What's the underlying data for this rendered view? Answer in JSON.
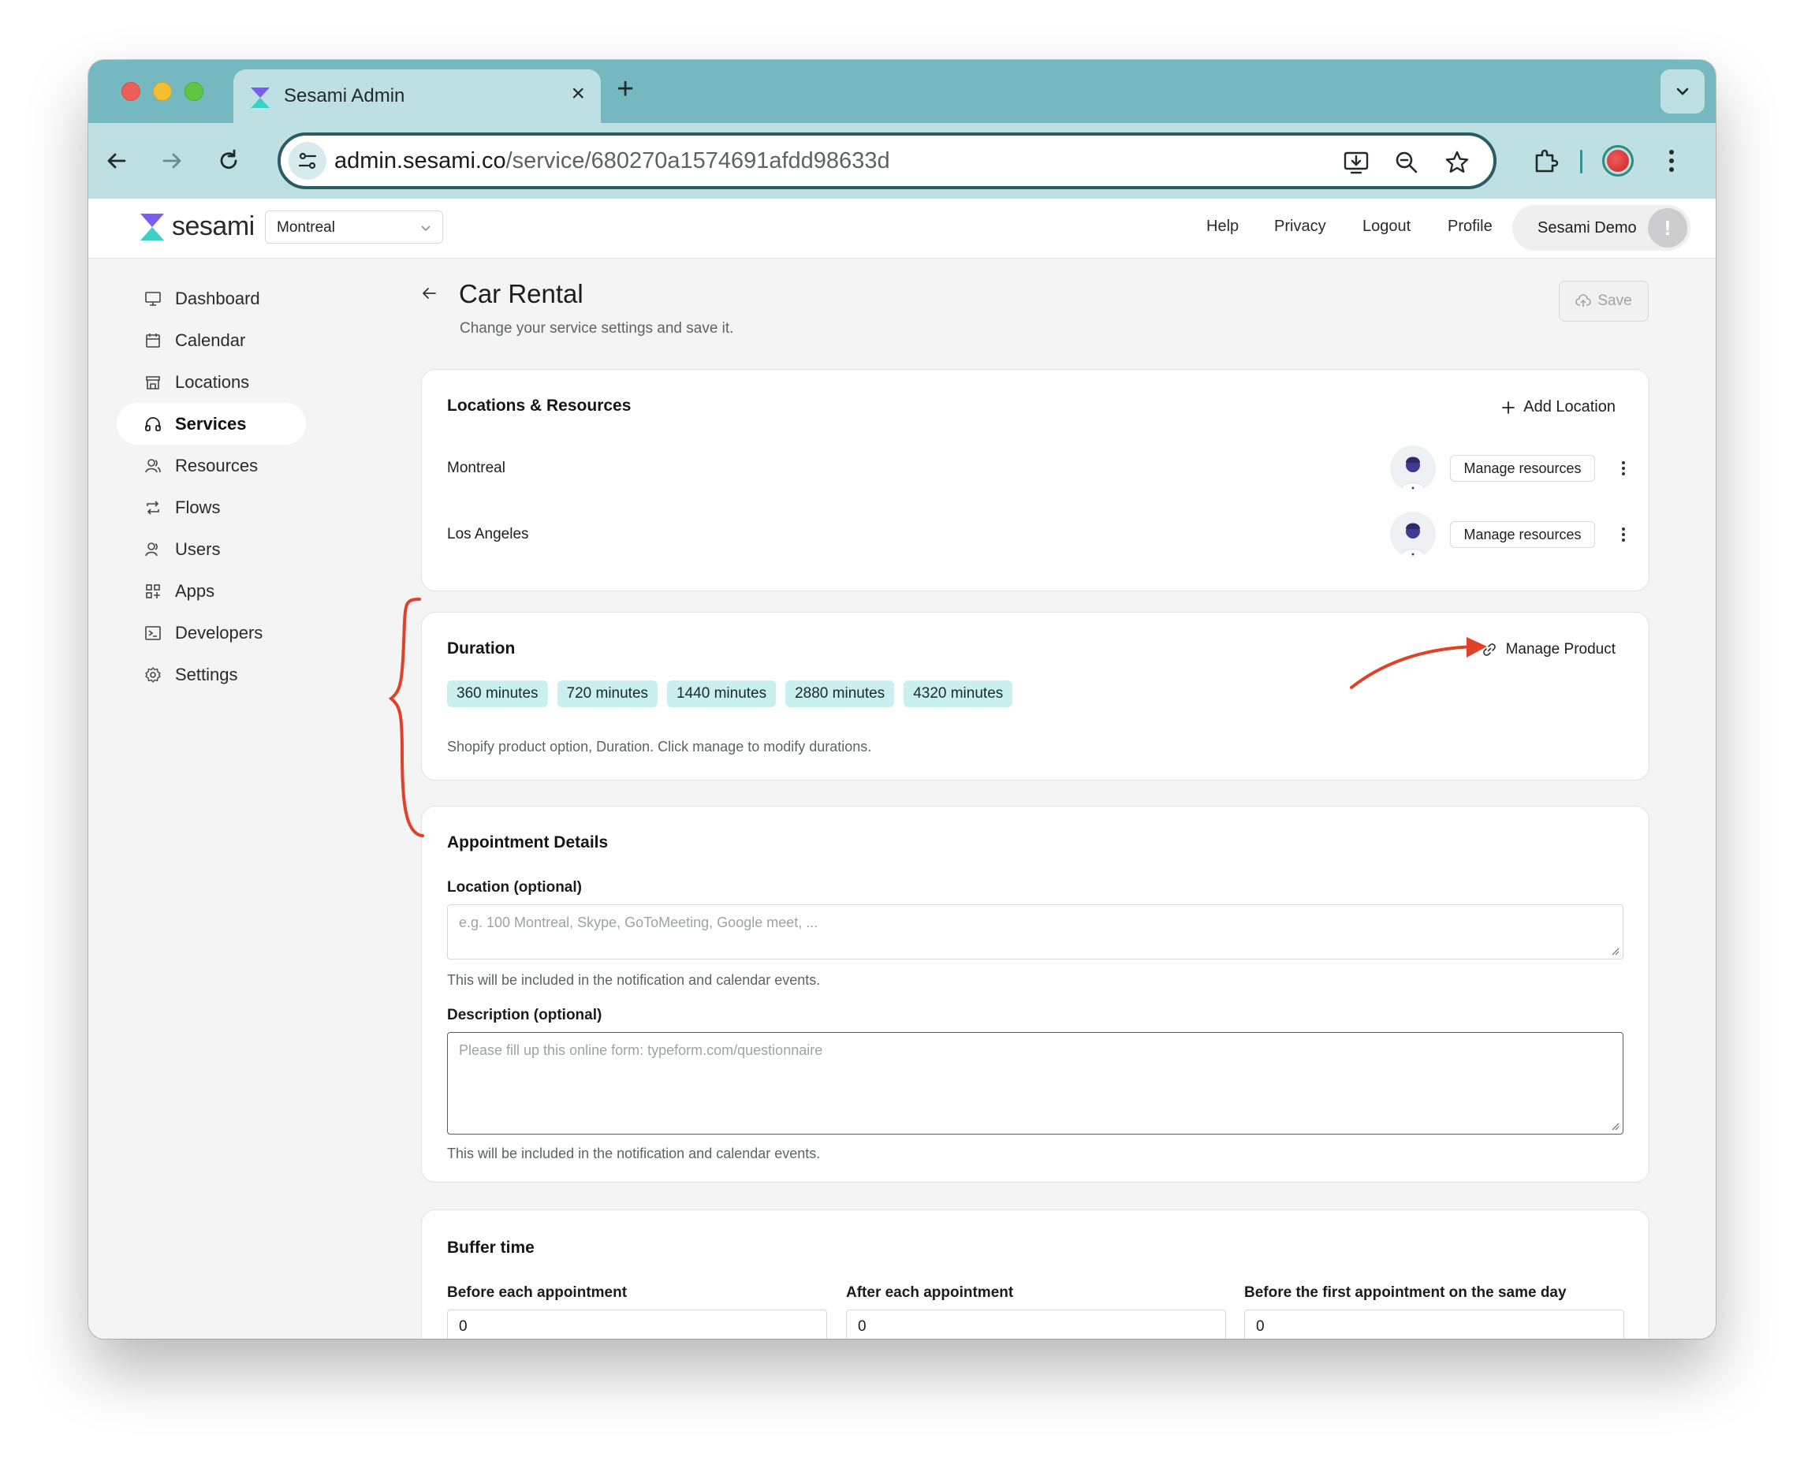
{
  "browser": {
    "tab_title": "Sesami Admin",
    "url_host": "admin.sesami.co",
    "url_path": "/service/680270a1574691afdd98633d"
  },
  "header": {
    "logo_text": "sesami",
    "location_select": "Montreal",
    "links": {
      "help": "Help",
      "privacy": "Privacy",
      "logout": "Logout",
      "profile": "Profile"
    },
    "user_name": "Sesami Demo",
    "user_avatar": "!"
  },
  "sidebar": {
    "items": [
      {
        "label": "Dashboard",
        "icon": "monitor-icon"
      },
      {
        "label": "Calendar",
        "icon": "calendar-icon"
      },
      {
        "label": "Locations",
        "icon": "store-icon"
      },
      {
        "label": "Services",
        "icon": "headphones-icon",
        "active": true
      },
      {
        "label": "Resources",
        "icon": "users-icon"
      },
      {
        "label": "Flows",
        "icon": "repeat-icon"
      },
      {
        "label": "Users",
        "icon": "user-icon"
      },
      {
        "label": "Apps",
        "icon": "apps-icon"
      },
      {
        "label": "Developers",
        "icon": "terminal-icon"
      },
      {
        "label": "Settings",
        "icon": "gear-icon"
      }
    ]
  },
  "page": {
    "title": "Car Rental",
    "subtitle": "Change your service settings and save it.",
    "save_label": "Save"
  },
  "locations_card": {
    "title": "Locations & Resources",
    "add_label": "Add Location",
    "rows": [
      {
        "name": "Montreal",
        "manage_label": "Manage resources"
      },
      {
        "name": "Los Angeles",
        "manage_label": "Manage resources"
      }
    ]
  },
  "duration_card": {
    "title": "Duration",
    "manage_label": "Manage Product",
    "chips": [
      "360 minutes",
      "720 minutes",
      "1440 minutes",
      "2880 minutes",
      "4320 minutes"
    ],
    "help": "Shopify product option, Duration. Click manage to modify durations."
  },
  "appointment_card": {
    "title": "Appointment Details",
    "location_label": "Location (optional)",
    "location_placeholder": "e.g. 100 Montreal, Skype, GoToMeeting, Google meet, ...",
    "location_help": "This will be included in the notification and calendar events.",
    "description_label": "Description (optional)",
    "description_placeholder": "Please fill up this online form: typeform.com/questionnaire",
    "description_help": "This will be included in the notification and calendar events."
  },
  "buffer_card": {
    "title": "Buffer time",
    "before_label": "Before each appointment",
    "before_value": "0",
    "after_label": "After each appointment",
    "after_value": "0",
    "first_label": "Before the first appointment on the same day",
    "first_value": "0"
  },
  "colors": {
    "browser_chrome": "#76b8bf",
    "toolbar": "#bfe0e3",
    "chip_bg": "#c9f0ee",
    "annotation_red": "#e0412b"
  }
}
